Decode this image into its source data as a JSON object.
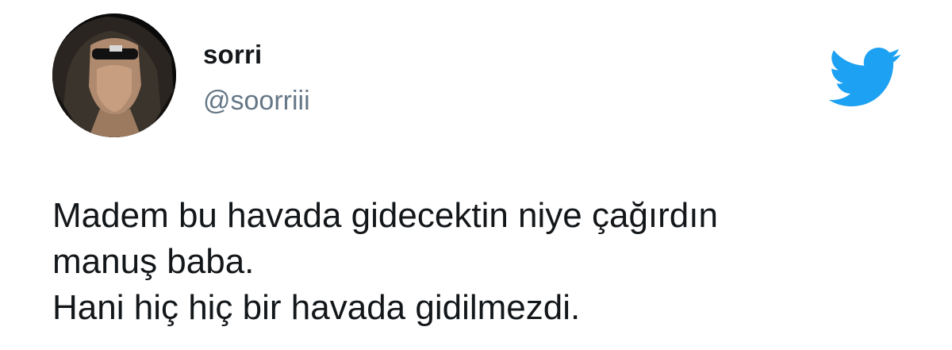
{
  "user": {
    "display_name": "sorri",
    "handle": "@soorriii",
    "avatar_icon": "profile-photo"
  },
  "brand": {
    "icon": "twitter-bird-icon",
    "color": "#1da1f2"
  },
  "tweet": {
    "lines": [
      "Madem bu havada gidecektin niye çağırdın",
      "manuş baba.",
      "Hani hiç hiç bir havada gidilmezdi."
    ]
  },
  "colors": {
    "name": "#14171a",
    "handle": "#657786",
    "text": "#14171a",
    "background": "#ffffff"
  }
}
